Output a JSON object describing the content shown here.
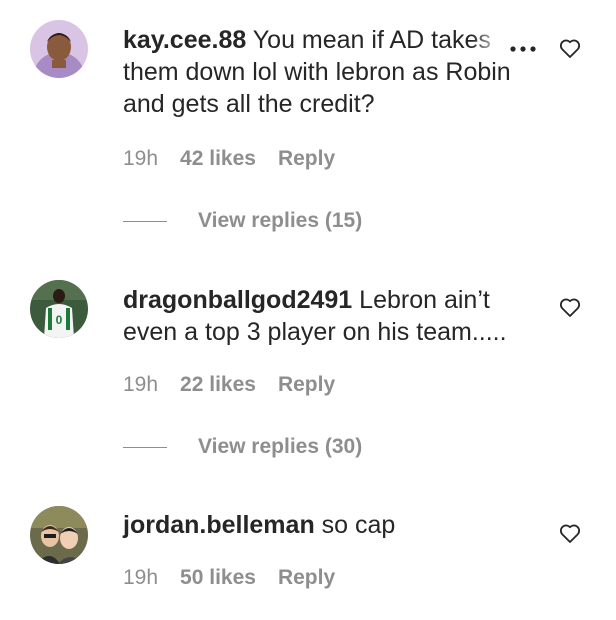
{
  "comments": [
    {
      "username": "kay.cee.88",
      "text": "You mean if AD takes them down lol with lebron as Robin and gets all the credit?",
      "time": "19h",
      "likes": "42 likes",
      "reply": "Reply",
      "view_replies": "View replies (15)",
      "avatar_icon": "profile-photo"
    },
    {
      "username": "dragonballgod2491",
      "text": "Lebron ain’t even a top 3 player on his team.....",
      "time": "19h",
      "likes": "22 likes",
      "reply": "Reply",
      "view_replies": "View replies (30)",
      "avatar_icon": "profile-photo"
    },
    {
      "username": "jordan.belleman",
      "text": "so cap",
      "time": "19h",
      "likes": "50 likes",
      "reply": "Reply",
      "avatar_icon": "profile-photo"
    }
  ],
  "icons": {
    "like": "heart-outline-icon",
    "more": "more-options-icon"
  },
  "colors": {
    "text": "#262626",
    "secondary": "#8e8e8e",
    "background": "#ffffff"
  }
}
